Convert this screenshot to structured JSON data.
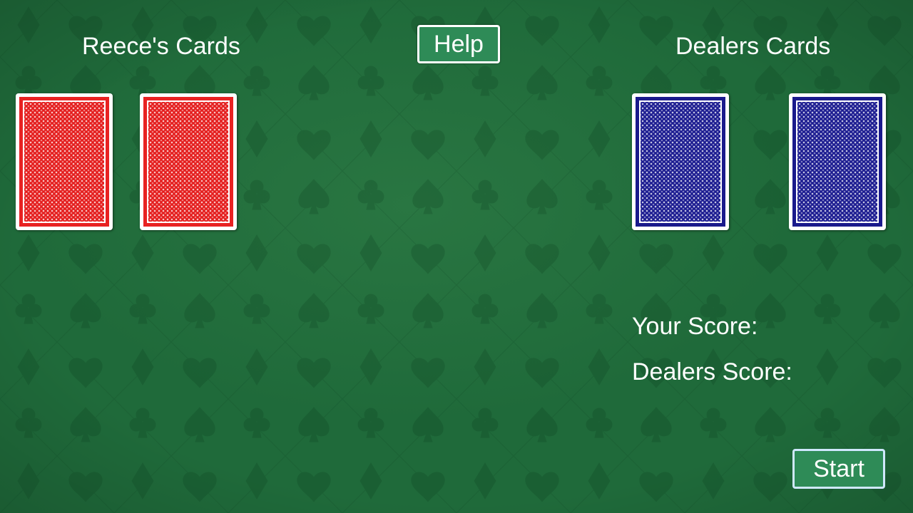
{
  "player": {
    "title": "Reece's Cards",
    "cards": [
      {
        "face": "down",
        "back_color": "#e41c1c"
      },
      {
        "face": "down",
        "back_color": "#e41c1c"
      }
    ]
  },
  "dealer": {
    "title": "Dealers Cards",
    "cards": [
      {
        "face": "down",
        "back_color": "#1b1b90"
      },
      {
        "face": "down",
        "back_color": "#1b1b90"
      }
    ]
  },
  "toolbar": {
    "help_label": "Help",
    "start_label": "Start"
  },
  "scores": {
    "your_label": "Your Score:",
    "dealer_label": "Dealers Score:"
  },
  "theme": {
    "table_color": "#1f6a3a",
    "button_color": "#2e8b57",
    "background_pattern": "card-suits"
  }
}
